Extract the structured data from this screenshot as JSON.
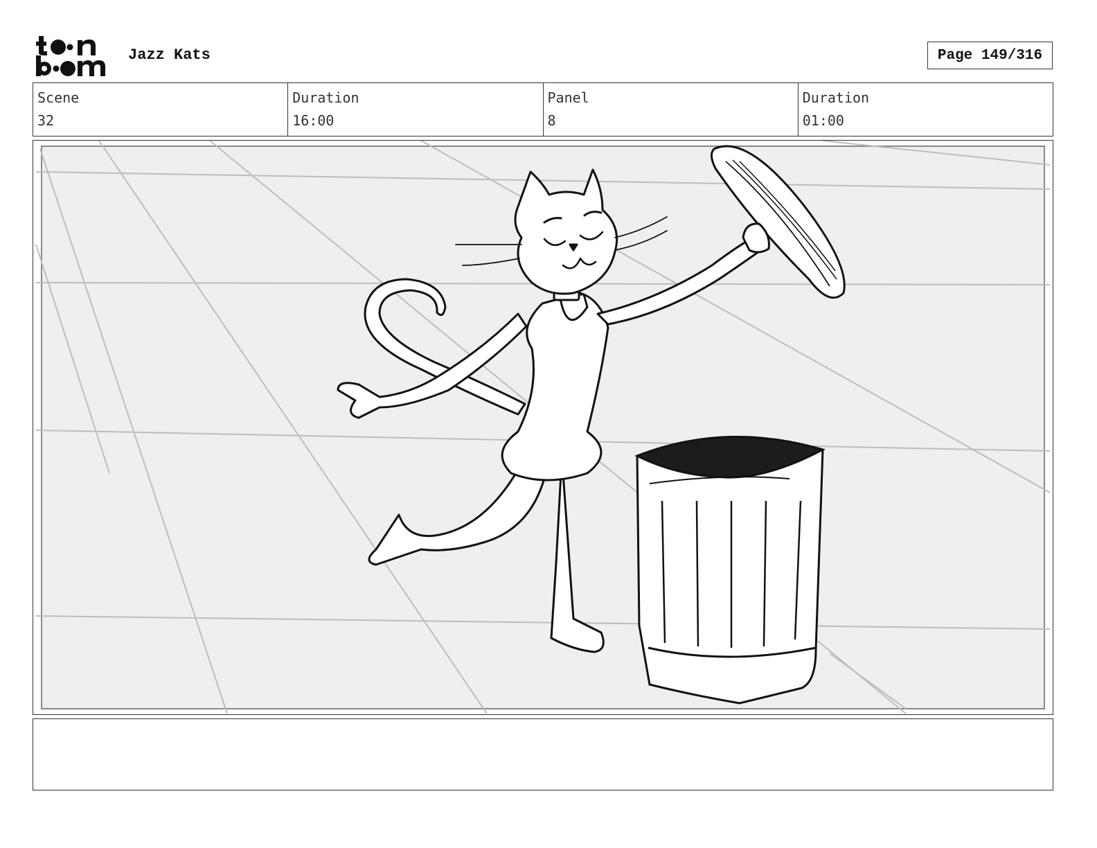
{
  "header": {
    "logo_label": "toon boom",
    "project_title": "Jazz Kats",
    "page_indicator": "Page 149/316"
  },
  "info_row": [
    {
      "label": "Scene",
      "value": "32"
    },
    {
      "label": "Duration",
      "value": "16:00"
    },
    {
      "label": "Panel",
      "value": "8"
    },
    {
      "label": "Duration",
      "value": "01:00"
    }
  ],
  "notes": {
    "text": ""
  },
  "colors": {
    "frame_border": "#333333",
    "panel_background": "#efefef",
    "perspective_lines": "#bdbdbd",
    "ink": "#111111"
  }
}
